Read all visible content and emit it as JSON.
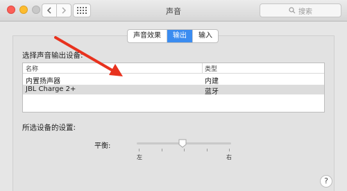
{
  "window": {
    "title": "声音",
    "search_placeholder": "搜索"
  },
  "tabs": [
    {
      "label": "声音效果",
      "active": false
    },
    {
      "label": "输出",
      "active": true
    },
    {
      "label": "输入",
      "active": false
    }
  ],
  "output": {
    "select_label": "选择声音输出设备:",
    "columns": [
      "名称",
      "类型"
    ],
    "devices": [
      {
        "name": "内置扬声器",
        "type": "内建",
        "selected": false
      },
      {
        "name": "JBL Charge 2+",
        "type": "蓝牙",
        "selected": true
      }
    ],
    "settings_label": "所选设备的设置:",
    "balance": {
      "label": "平衡:",
      "left": "左",
      "right": "右",
      "value": 0.5
    }
  },
  "help": "?",
  "colors": {
    "accent": "#3b8cf0",
    "annotation_arrow": "#e8321e"
  },
  "icons": [
    "close-button",
    "minimize-button",
    "zoom-button",
    "chevron-left-icon",
    "chevron-right-icon",
    "grid-icon",
    "search-icon",
    "help-icon"
  ]
}
